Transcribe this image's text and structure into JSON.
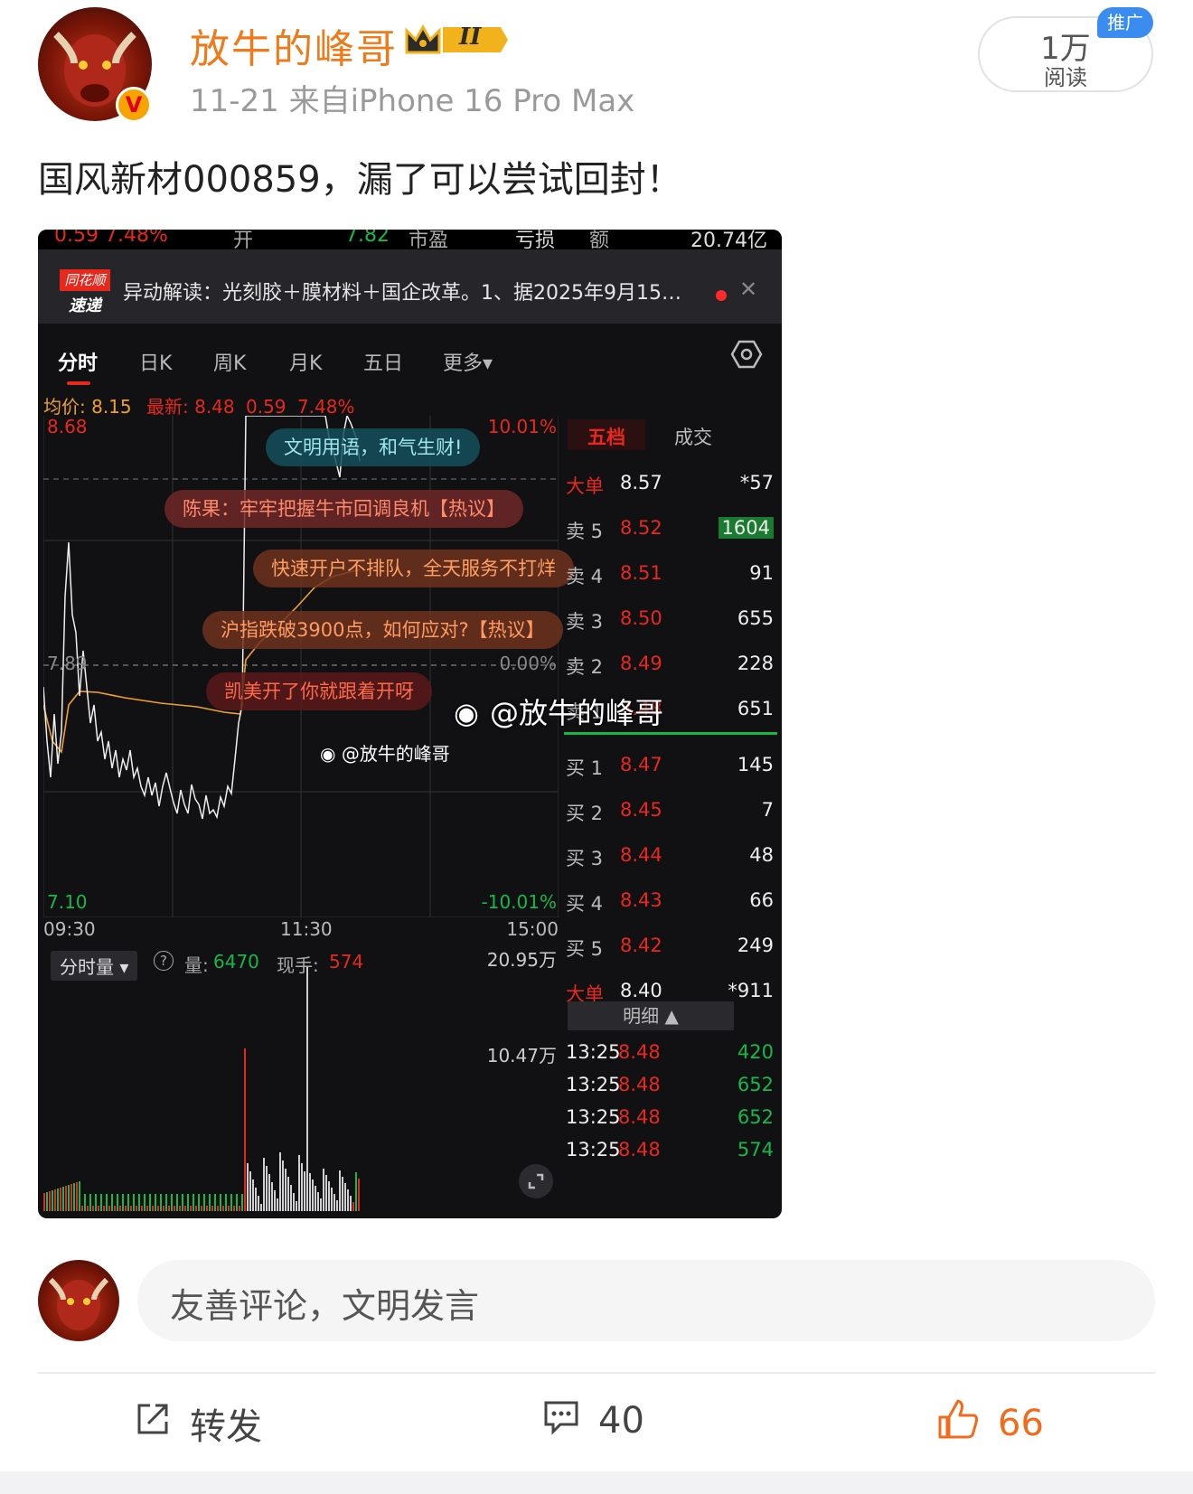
{
  "post": {
    "username": "放牛的峰哥",
    "level_badge": "II",
    "meta": "11-21  来自iPhone 16 Pro Max",
    "reads_count": "1万",
    "reads_label": "阅读",
    "promo_tag": "推广",
    "verified_badge": "V",
    "text": "国风新材000859，漏了可以尝试回封！"
  },
  "screenshot": {
    "top_row": [
      "0.59  7.48%",
      "开",
      "7.82",
      "市盈",
      "亏损",
      "额",
      "20.74亿"
    ],
    "news_logo_top": "同花顺",
    "news_logo_bottom": "速递",
    "news_text": "异动解读：光刻胶＋膜材料＋国企改革。1、据2025年9月15…",
    "news_close": "✕",
    "tabs": [
      "分时",
      "日K",
      "周K",
      "月K",
      "五日",
      "更多▾"
    ],
    "info_avg": "均价: 8.15",
    "info_latest": "最新: 8.48",
    "info_change": "0.59",
    "info_pct": "7.48%",
    "price_high": "8.68",
    "price_mid": "7.89",
    "price_low": "7.10",
    "pct_high": "10.01%",
    "pct_mid": "0.00%",
    "pct_low": "-10.01%",
    "time_labels": [
      "09:30",
      "11:30",
      "15:00"
    ],
    "bubbles": [
      "文明用语，和气生财!",
      "陈果：牢牢把握牛市回调良机【热议】",
      "快速开户不排队，全天服务不打烊",
      "沪指跌破3900点，如何应对?【热议】",
      "凯美开了你就跟着开呀"
    ],
    "watermark_big": "@放牛的峰哥",
    "watermark_small": "@放牛的峰哥",
    "volume_selector": "分时量 ▾",
    "volume_help": "?",
    "volume_qty_label": "量:",
    "volume_qty": "6470",
    "volume_now_label": "现手:",
    "volume_now": "574",
    "vol_max": "20.95万",
    "vol_mid": "10.47万",
    "panel_tabs": [
      "五档",
      "成交"
    ],
    "order_book": [
      {
        "label": "大单",
        "price": "8.57",
        "qty": "*57"
      },
      {
        "label": "卖 5",
        "price": "8.52",
        "qty": "1604"
      },
      {
        "label": "卖 4",
        "price": "8.51",
        "qty": "91"
      },
      {
        "label": "卖 3",
        "price": "8.50",
        "qty": "655"
      },
      {
        "label": "卖 2",
        "price": "8.49",
        "qty": "228"
      },
      {
        "label": "卖 1",
        "price": "8.48",
        "qty": "651"
      },
      {
        "label": "买 1",
        "price": "8.47",
        "qty": "145"
      },
      {
        "label": "买 2",
        "price": "8.45",
        "qty": "7"
      },
      {
        "label": "买 3",
        "price": "8.44",
        "qty": "48"
      },
      {
        "label": "买 4",
        "price": "8.43",
        "qty": "66"
      },
      {
        "label": "买 5",
        "price": "8.42",
        "qty": "249"
      },
      {
        "label": "大单",
        "price": "8.40",
        "qty": "*911"
      }
    ],
    "detail_header": "明细 ▲",
    "ticks": [
      {
        "time": "13:25",
        "price": "8.48",
        "qty": "420"
      },
      {
        "time": "13:25",
        "price": "8.48",
        "qty": "652"
      },
      {
        "time": "13:25",
        "price": "8.48",
        "qty": "652"
      },
      {
        "time": "13:25",
        "price": "8.48",
        "qty": "574"
      }
    ],
    "colors": {
      "up": "#e8281c",
      "down": "#16b84a",
      "avg_line": "#f0a030",
      "bg": "#111114"
    }
  },
  "comment": {
    "placeholder": "友善评论，文明发言"
  },
  "actions": {
    "repost_label": "转发",
    "comments_count": "40",
    "likes_count": "66"
  }
}
